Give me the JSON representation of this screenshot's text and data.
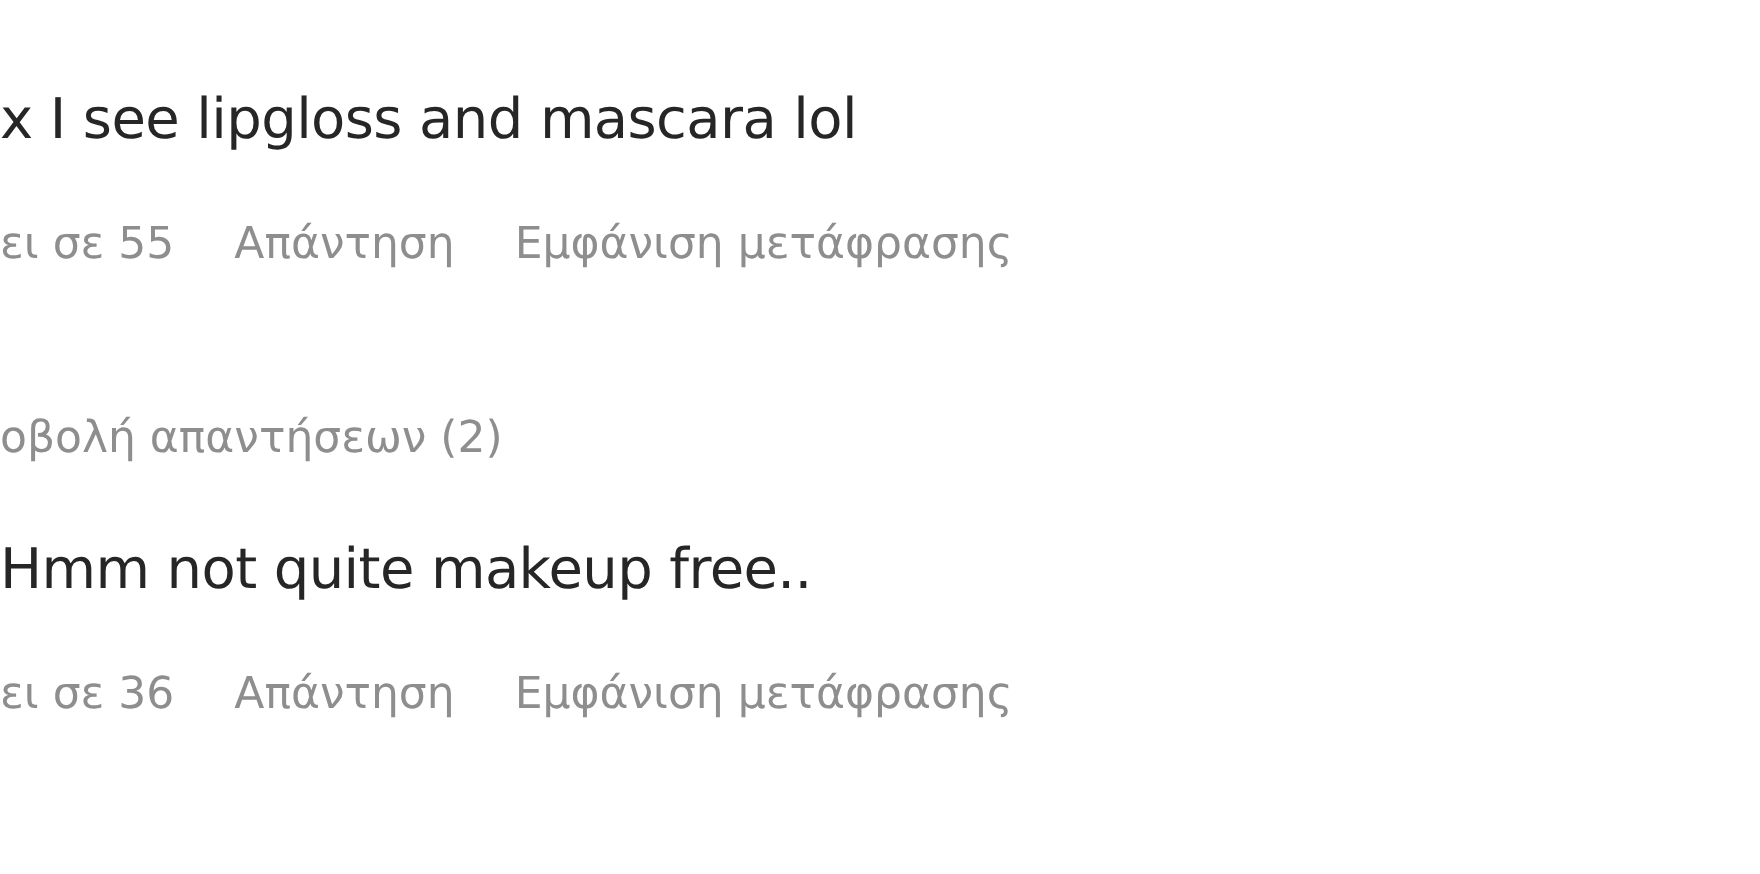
{
  "comments": [
    {
      "text": "x I see lipgloss and mascara lol",
      "time": "ει σε 55",
      "reply": "Απάντηση",
      "translate": "Εμφάνιση μετάφρασης",
      "view_replies": "οβολή απαντήσεων (2)"
    },
    {
      "text": "Hmm not quite makeup free..",
      "time": "ει σε 36",
      "reply": "Απάντηση",
      "translate": "Εμφάνιση μετάφρασης"
    }
  ]
}
